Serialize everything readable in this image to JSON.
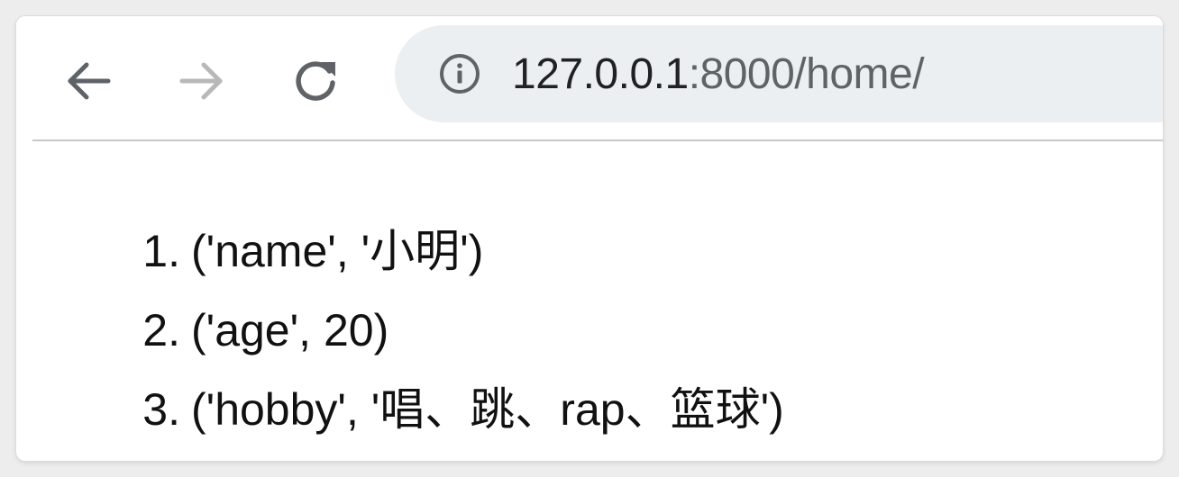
{
  "browser": {
    "nav": {
      "back_icon": "arrow-left-icon",
      "forward_icon": "arrow-right-icon",
      "reload_icon": "reload-icon"
    },
    "omnibox": {
      "info_icon": "info-circle-icon",
      "url_host": "127.0.0.1",
      "url_rest": ":8000/home/"
    }
  },
  "page": {
    "items": [
      {
        "number": "1.",
        "text": "('name', '小明')"
      },
      {
        "number": "2.",
        "text": "('age', 20)"
      },
      {
        "number": "3.",
        "text": "('hobby', '唱、跳、rap、篮球')"
      }
    ]
  },
  "colors": {
    "omnibox_bg": "#eceff1",
    "icon_active": "#5f6368",
    "icon_disabled": "#b8b8b8",
    "text": "#111111"
  }
}
